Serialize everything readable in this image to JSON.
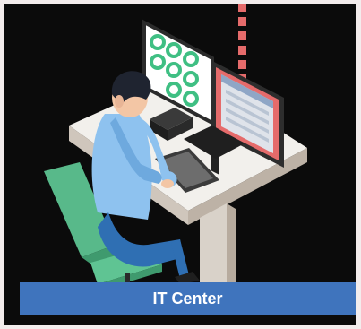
{
  "tile": {
    "label": "IT Center",
    "illustration_icon": "person-at-computer-workstation-illustration"
  },
  "colors": {
    "label_bar": "#3f74bd",
    "card_bg": "#0b0b0b",
    "page_bg": "#f3eded",
    "accent_red": "#e56b6b",
    "monitor_green": "#3fbf83"
  }
}
